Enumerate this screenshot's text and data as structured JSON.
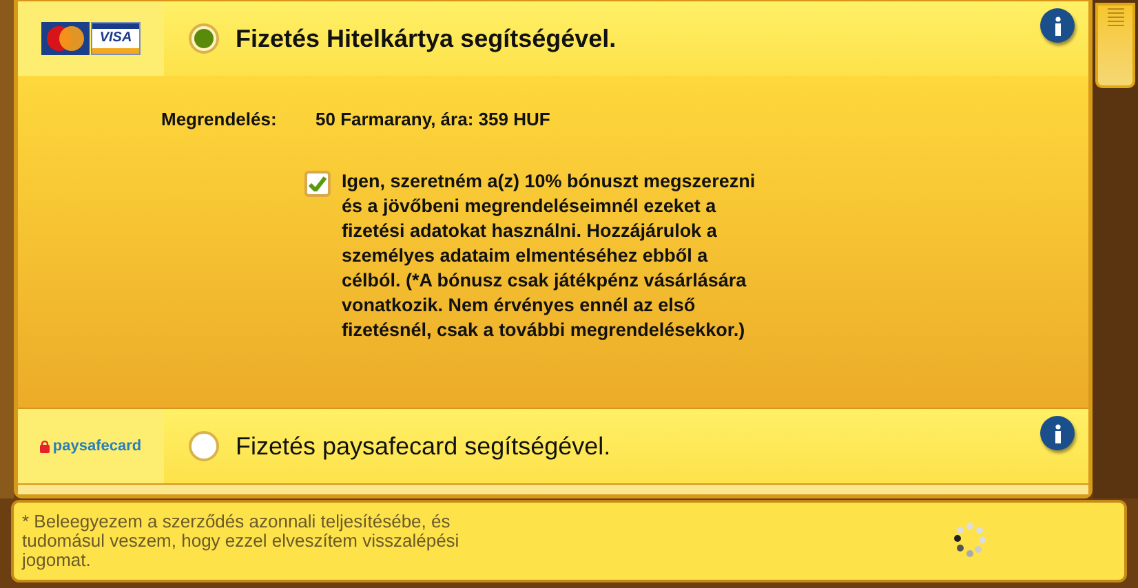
{
  "payment_options": [
    {
      "kind": "card",
      "logo_text": "VISA",
      "label": "Fizetés Hitelkártya segítségével.",
      "selected": true,
      "order": {
        "label": "Megrendelés:",
        "value": "50 Farmarany, ára: 359 HUF"
      },
      "bonus": {
        "checked": true,
        "text": "Igen, szeretném a(z) 10% bónuszt megszerezni és a jövőbeni megrendeléseimnél ezeket a fizetési adatokat használni. Hozzájárulok a személyes adataim elmentéséhez ebből a célból. (*A bónusz csak játékpénz vásárlására vonatkozik. Nem érvényes ennél az első fizetésnél, csak a további megrendelésekkor.)"
      }
    },
    {
      "kind": "paysafe",
      "logo_text": "paysafecard",
      "label": "Fizetés paysafecard segítségével.",
      "selected": false
    }
  ],
  "footer_note": "* Beleegyezem a szerződés azonnali teljesítésébe, és tudomásul veszem, hogy ezzel elveszítem visszalépési jogomat."
}
